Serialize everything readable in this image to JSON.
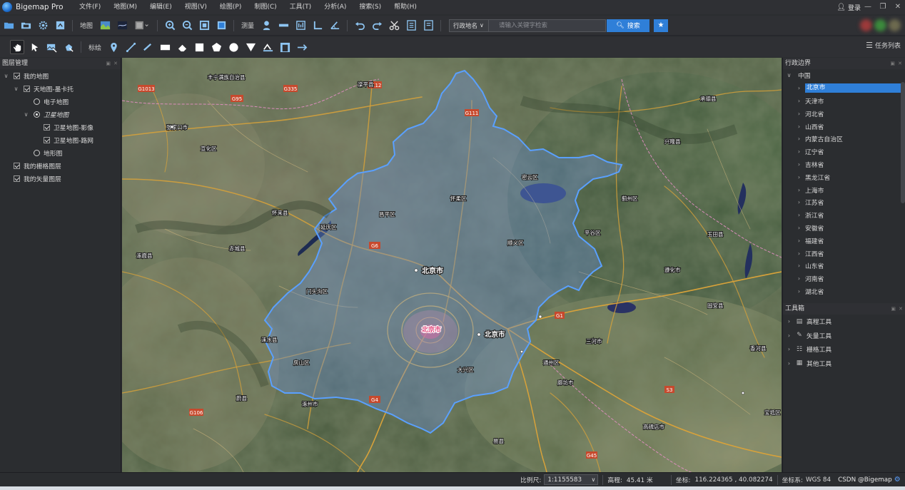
{
  "app": {
    "title": "Bigemap Pro"
  },
  "menu": [
    "文件(F)",
    "地图(M)",
    "编辑(E)",
    "视图(V)",
    "绘图(P)",
    "制图(C)",
    "工具(T)",
    "分析(A)",
    "搜索(S)",
    "帮助(H)"
  ],
  "login": "登录",
  "toolbar1": {
    "map_label": "地图",
    "measure_label": "测量",
    "region_select": "行政地名",
    "search_placeholder": "请输入关键字检索",
    "search_button": "搜索"
  },
  "toolbar2": {
    "mark_label": "标绘",
    "task_list": "任务列表"
  },
  "layer_panel": {
    "title": "图层管理",
    "items": [
      {
        "label": "我的地图",
        "level": 0,
        "kind": "check",
        "expand": true
      },
      {
        "label": "天地图-墨卡托",
        "level": 1,
        "kind": "check",
        "expand": true
      },
      {
        "label": "电子地图",
        "level": 2,
        "kind": "radio",
        "selected": false
      },
      {
        "label": "卫星地图",
        "level": 2,
        "kind": "radio",
        "selected": true,
        "expand": true,
        "italic": true
      },
      {
        "label": "卫星地图-影像",
        "level": 3,
        "kind": "check"
      },
      {
        "label": "卫星地图-路网",
        "level": 3,
        "kind": "check"
      },
      {
        "label": "地形图",
        "level": 2,
        "kind": "radio",
        "selected": false
      },
      {
        "label": "我的矢量图层",
        "level": 0,
        "kind": "check",
        "display": "我的栅格图层"
      },
      {
        "label": "我的矢量图层",
        "level": 0,
        "kind": "check"
      }
    ]
  },
  "map": {
    "city_label": "北京市",
    "city_label_2": "北京市",
    "center_label": "北京市",
    "labels": [
      {
        "t": "张家口市"
      },
      {
        "t": "宣化区"
      },
      {
        "t": "怀来县"
      },
      {
        "t": "延庆区"
      },
      {
        "t": "怀柔区"
      },
      {
        "t": "密云区"
      },
      {
        "t": "平谷区"
      },
      {
        "t": "顺义区"
      },
      {
        "t": "昌平区"
      },
      {
        "t": "门头沟区"
      },
      {
        "t": "房山区"
      },
      {
        "t": "大兴区"
      },
      {
        "t": "通州区"
      },
      {
        "t": "涿州市"
      },
      {
        "t": "廊坊市"
      },
      {
        "t": "三河市"
      },
      {
        "t": "蓟州区"
      },
      {
        "t": "兴隆县"
      },
      {
        "t": "承德县"
      },
      {
        "t": "滦平县"
      },
      {
        "t": "丰宁满族自治县"
      },
      {
        "t": "赤城县"
      },
      {
        "t": "涿鹿县"
      },
      {
        "t": "蔚县"
      },
      {
        "t": "涞水县"
      },
      {
        "t": "易县"
      },
      {
        "t": "高碑店市"
      },
      {
        "t": "固安县"
      },
      {
        "t": "香河县"
      },
      {
        "t": "宝坻区"
      },
      {
        "t": "玉田县"
      },
      {
        "t": "遵化市"
      }
    ],
    "roads": [
      "G1013",
      "G95",
      "G335",
      "G112",
      "G111",
      "G6",
      "G4",
      "G106",
      "G45",
      "S3",
      "G1"
    ]
  },
  "region_panel": {
    "title": "行政边界",
    "root": "中国",
    "items": [
      "北京市",
      "天津市",
      "河北省",
      "山西省",
      "内蒙古自治区",
      "辽宁省",
      "吉林省",
      "黑龙江省",
      "上海市",
      "江苏省",
      "浙江省",
      "安徽省",
      "福建省",
      "江西省",
      "山东省",
      "河南省",
      "湖北省"
    ],
    "selected_index": 0
  },
  "toolbox": {
    "title": "工具箱",
    "items": [
      {
        "label": "高程工具",
        "icon": "elevation-icon"
      },
      {
        "label": "矢量工具",
        "icon": "pen-icon"
      },
      {
        "label": "栅格工具",
        "icon": "grid-icon"
      },
      {
        "label": "其他工具",
        "icon": "apps-icon"
      }
    ]
  },
  "status": {
    "scale_label": "比例尺:",
    "scale_value": "1:1155583",
    "elev_label": "高程:",
    "elev_value": "45.41 米",
    "coord_label": "坐标:",
    "coord_value": "116.224365 , 40.082274",
    "crs_label": "坐标系:",
    "crs_value": "WGS 84",
    "watermark": "CSDN @Bigemap"
  },
  "colors": {
    "accent": "#2f7fd8",
    "boundary_fill": "#6a8fd6",
    "boundary_stroke": "#5aa0ff"
  }
}
